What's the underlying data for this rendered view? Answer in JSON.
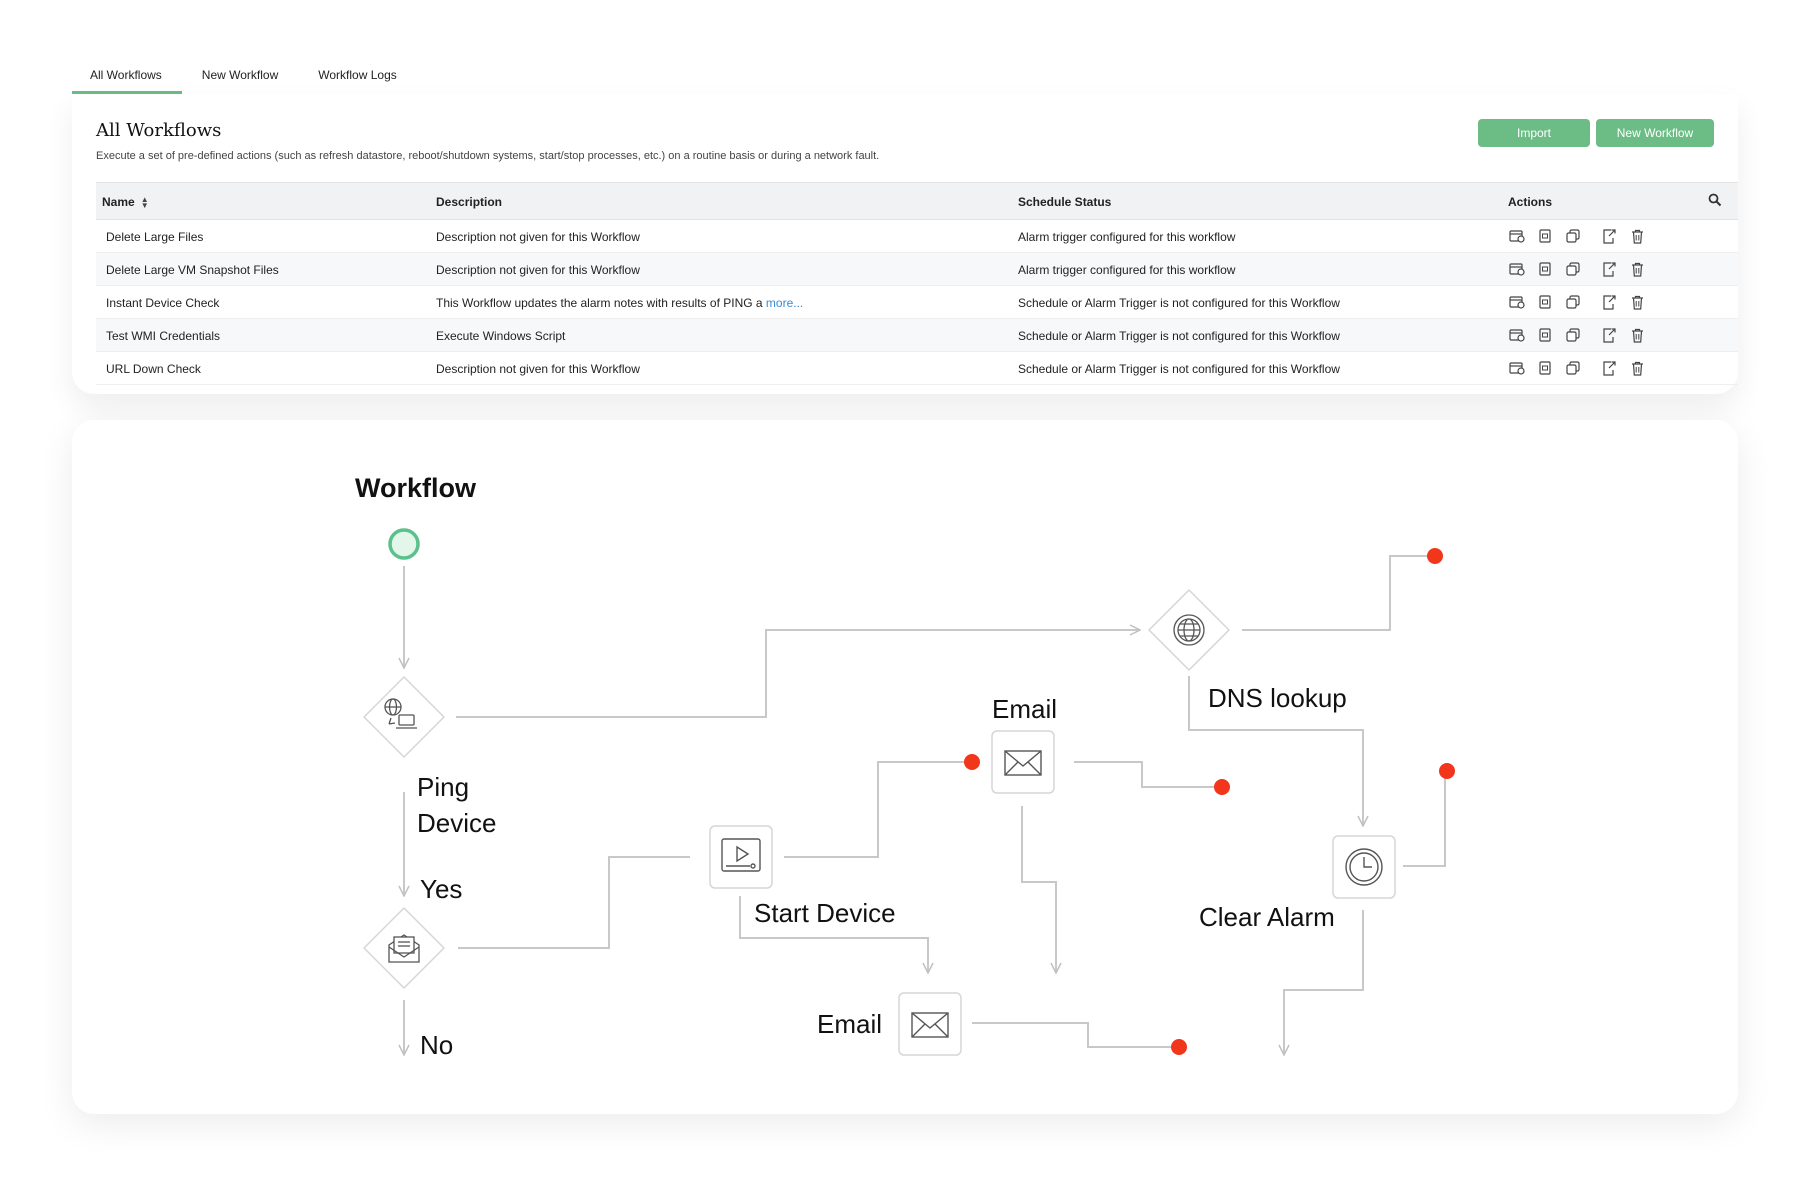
{
  "tabs": [
    {
      "label": "All Workflows",
      "active": true
    },
    {
      "label": "New Workflow",
      "active": false
    },
    {
      "label": "Workflow Logs",
      "active": false
    }
  ],
  "header": {
    "title": "All Workflows",
    "description": "Execute a set of pre-defined actions (such as refresh datastore, reboot/shutdown systems, start/stop processes, etc.) on a routine basis or during a network fault.",
    "import_label": "Import",
    "new_workflow_label": "New Workflow"
  },
  "table": {
    "columns": {
      "name": "Name",
      "description": "Description",
      "schedule": "Schedule Status",
      "actions": "Actions"
    },
    "rows": [
      {
        "name": "Delete Large Files",
        "description": "Description not given for this Workflow",
        "schedule": "Alarm trigger configured for this workflow"
      },
      {
        "name": "Delete Large VM Snapshot Files",
        "description": "Description not given for this Workflow",
        "schedule": "Alarm trigger configured for this workflow"
      },
      {
        "name": "Instant Device Check",
        "description": "This Workflow updates the alarm notes with results of PING a",
        "more": "more...",
        "schedule": "Schedule or Alarm Trigger is not configured for this Workflow"
      },
      {
        "name": "Test WMI Credentials",
        "description": "Execute Windows Script",
        "schedule": "Schedule or Alarm Trigger is not configured for this Workflow"
      },
      {
        "name": "URL Down Check",
        "description": "Description not given for this Workflow",
        "schedule": "Schedule or Alarm Trigger is not configured for this Workflow"
      }
    ]
  },
  "diagram": {
    "title": "Workflow",
    "ping_line1": "Ping",
    "ping_line2": "Device",
    "yes": "Yes",
    "no": "No",
    "dns": "DNS lookup",
    "email_top": "Email",
    "start_device": "Start Device",
    "email_bottom": "Email",
    "clear_alarm": "Clear Alarm"
  },
  "colors": {
    "accent": "#6bbd85",
    "start_node": "#5cc08a",
    "end_dot": "#f2361c",
    "connector": "#c8c8c8"
  }
}
